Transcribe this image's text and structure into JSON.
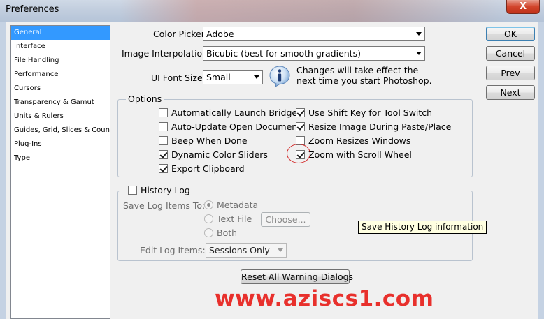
{
  "window": {
    "title": "Preferences",
    "close_label": "X"
  },
  "sidebar": {
    "items": [
      {
        "label": "General"
      },
      {
        "label": "Interface"
      },
      {
        "label": "File Handling"
      },
      {
        "label": "Performance"
      },
      {
        "label": "Cursors"
      },
      {
        "label": "Transparency & Gamut"
      },
      {
        "label": "Units & Rulers"
      },
      {
        "label": "Guides, Grid, Slices & Count"
      },
      {
        "label": "Plug-Ins"
      },
      {
        "label": "Type"
      }
    ],
    "selected": "General"
  },
  "general": {
    "color_picker_label": "Color Picker:",
    "color_picker_value": "Adobe",
    "interpolation_label": "Image Interpolation:",
    "interpolation_value": "Bicubic (best for smooth gradients)",
    "ui_font_label": "UI Font Size:",
    "ui_font_value": "Small",
    "info_text": "Changes will take effect the next time you start Photoshop."
  },
  "options": {
    "title": "Options",
    "left": [
      {
        "label": "Automatically Launch Bridge",
        "checked": false
      },
      {
        "label": "Auto-Update Open Documents",
        "checked": false
      },
      {
        "label": "Beep When Done",
        "checked": false
      },
      {
        "label": "Dynamic Color Sliders",
        "checked": true
      },
      {
        "label": "Export Clipboard",
        "checked": true
      }
    ],
    "right": [
      {
        "label": "Use Shift Key for Tool Switch",
        "checked": true
      },
      {
        "label": "Resize Image During Paste/Place",
        "checked": true
      },
      {
        "label": "Zoom Resizes Windows",
        "checked": false
      },
      {
        "label": "Zoom with Scroll Wheel",
        "checked": true
      }
    ]
  },
  "history": {
    "title": "History Log",
    "checked": false,
    "save_label": "Save Log Items To:",
    "radios": [
      {
        "label": "Metadata",
        "selected": true
      },
      {
        "label": "Text File",
        "selected": false
      },
      {
        "label": "Both",
        "selected": false
      }
    ],
    "choose_label": "Choose...",
    "edit_label": "Edit Log Items:",
    "edit_value": "Sessions Only",
    "tooltip": "Save History Log information"
  },
  "buttons": {
    "ok": "OK",
    "cancel": "Cancel",
    "prev": "Prev",
    "next": "Next",
    "reset": "Reset All Warning Dialogs"
  },
  "watermark": "www.aziscs1.com",
  "colors": {
    "selection": "#3399ff",
    "watermark": "#e8302c",
    "annotation_circle": "#d32b2b",
    "close_button": "#c0321a"
  }
}
